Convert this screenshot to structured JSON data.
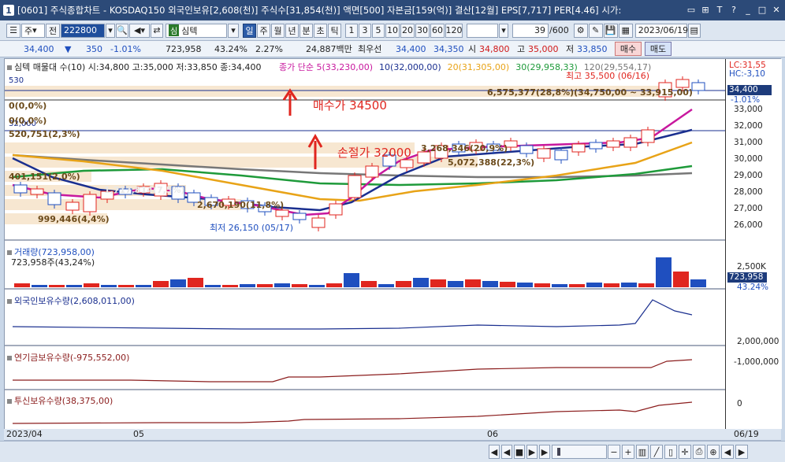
{
  "titlebar": {
    "window_number": "1",
    "text": "[0601] 주식종합차트 - KOSDAQ150 외국인보유[2,608(천)] 주식수[31,854(천)] 액면[500] 자본금[159(억)] 결산[12월] EPS[7,717] PER[4.46] 시가:"
  },
  "toolbar": {
    "type_select": "주",
    "prev_label": "전",
    "code": "222800",
    "stock_name": "심텍",
    "periods": [
      "일",
      "주",
      "월",
      "년",
      "분",
      "초",
      "틱"
    ],
    "selected_period": "일",
    "intervals": [
      "1",
      "3",
      "5",
      "10",
      "20",
      "30",
      "60",
      "120"
    ],
    "count": "39",
    "count_total": "/600",
    "date": "2023/06/19"
  },
  "quote": {
    "price": "34,400",
    "change": "350",
    "change_pct": "-1.01%",
    "volume": "723,958",
    "turnover_pct": "43.24%",
    "rate": "2.27%",
    "amount": "24,887백만",
    "best_ask_label": "최우선",
    "best_ask": "34,400",
    "best_bid": "34,350",
    "open_label": "시",
    "open": "34,800",
    "high_label": "고",
    "high": "35,000",
    "low_label": "저",
    "low": "33,850",
    "buy_button": "매수",
    "sell_button": "매도"
  },
  "price_panel": {
    "legend_candle": "심텍 매물대 수(10)  시:34,800 고:35,000 저:33,850 종:34,400",
    "legend_ma": [
      {
        "text": "종가 단순 5(33,230,00)",
        "color": "#c8189e"
      },
      {
        "text": "10(32,000,00)",
        "color": "#1a2f8f"
      },
      {
        "text": "20(31,305,00)",
        "color": "#e8a317"
      },
      {
        "text": "30(29,958,33)",
        "color": "#1e9a3a"
      },
      {
        "text": "120(29,554,17)",
        "color": "#777777"
      }
    ],
    "lc": "LC:31,55",
    "hc": "HC:-3,10",
    "price_tag": "34,400",
    "price_tag_pct": "-1.01%",
    "y_ticks": [
      "33,000",
      "32,000",
      "31,000",
      "30,000",
      "29,000",
      "28,000",
      "27,000",
      "26,000"
    ],
    "annotation_buy": "매수가 34500",
    "annotation_stop": "손절가 32000",
    "high_label": "최고 35,500 (06/16)",
    "low_label": "최저 26,150 (05/17)",
    "vp_labels": [
      "6,575,377(28,8%)(34,750,00 ~ 33,915,00)",
      "0(0,0%)",
      "0(0,0%)",
      "520,751(2,3%)",
      "3,268,346(20,9%)",
      "5,072,388(22,3%)",
      "401,151(2,0%)",
      "1,717,814(7,5%)",
      "2,670,190(11,8%)",
      "999,446(4,4%)"
    ],
    "left_levels": [
      "530",
      "32,000"
    ]
  },
  "volume_panel": {
    "legend": "거래량(723,958,00)",
    "sub": "723,958주(43,24%)",
    "y_tick": "2,500K",
    "tag": "723,958",
    "tag_pct": "43.24%"
  },
  "foreign_panel": {
    "legend": "외국인보유수량(2,608,011,00)",
    "y_tick": "2,000,000"
  },
  "pension_panel": {
    "legend": "연기금보유수량(-975,552,00)",
    "y_tick": "-1,000,000"
  },
  "trust_panel": {
    "legend": "투신보유수량(38,375,00)",
    "y_tick": "0"
  },
  "date_axis": [
    "2023/04",
    "05",
    "06",
    "06/19"
  ],
  "colors": {
    "up": "#e0261f",
    "down": "#1f4fbf",
    "ma5": "#c8189e",
    "ma10": "#1a2f8f",
    "ma20": "#e8a317",
    "ma30": "#1e9a3a",
    "ma120": "#777777"
  }
}
